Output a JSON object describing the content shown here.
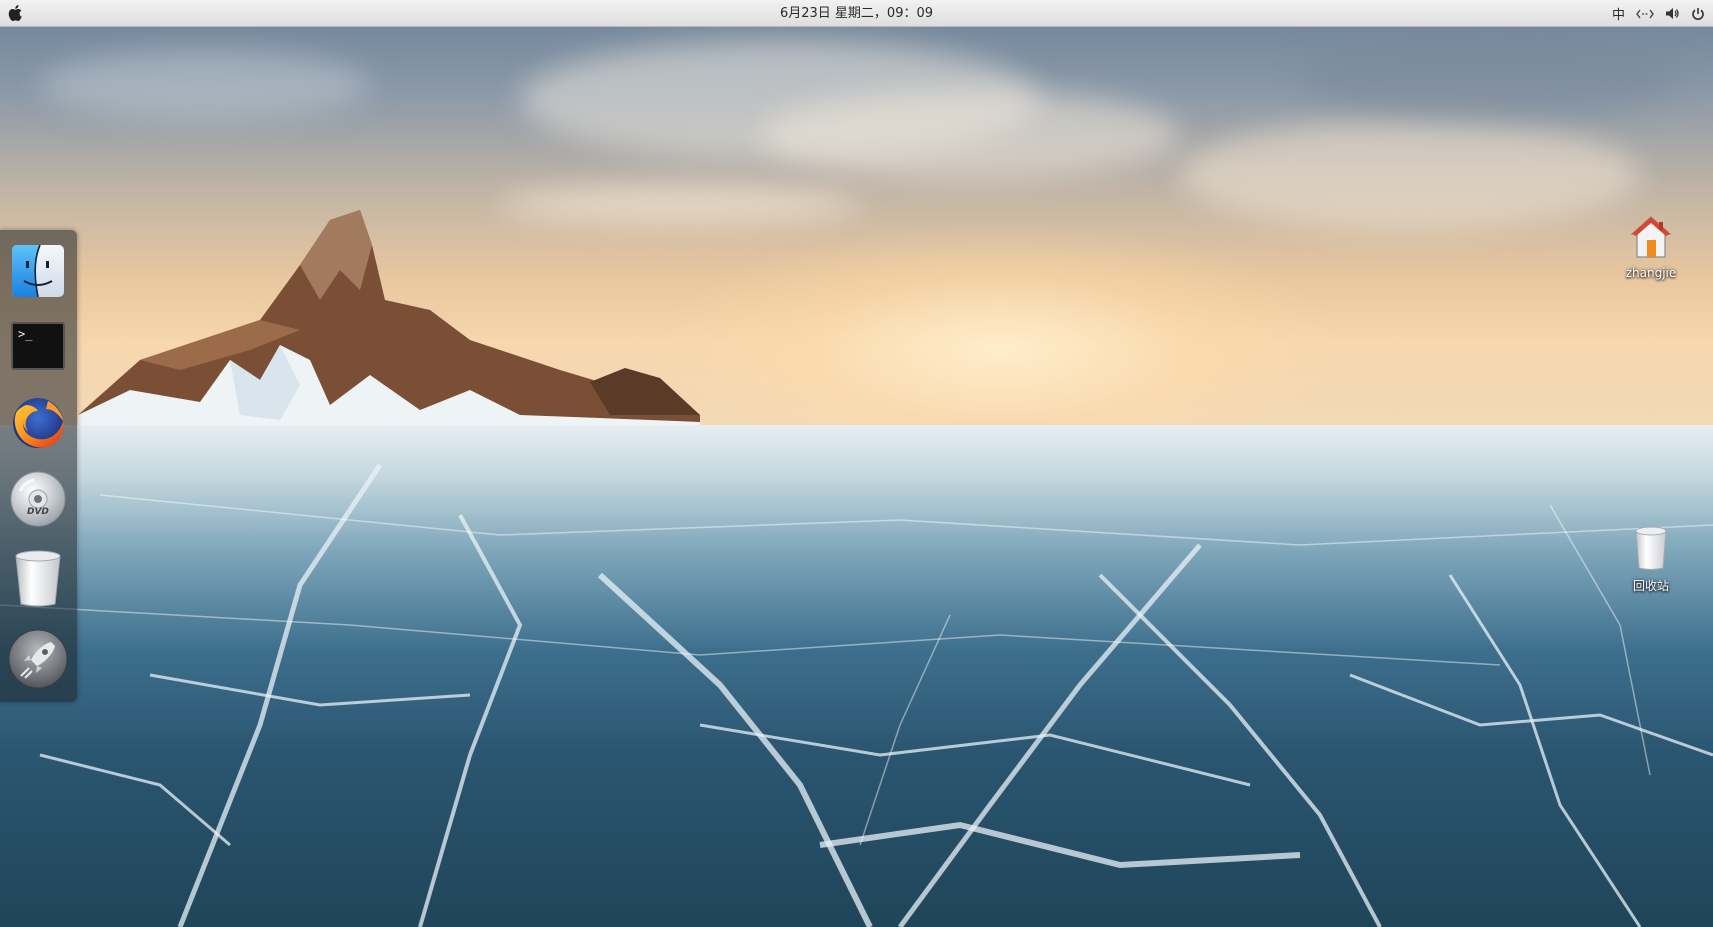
{
  "topbar": {
    "apple_menu_icon": "apple-logo-icon",
    "clock": "6月23日 星期二，09：09",
    "tray": {
      "input_method": "中",
      "network_icon": "network-icon",
      "volume_icon": "volume-icon",
      "power_icon": "power-icon"
    }
  },
  "dock": {
    "items": [
      {
        "name": "finder",
        "icon": "finder-icon"
      },
      {
        "name": "terminal",
        "icon": "terminal-icon",
        "prompt": ">_"
      },
      {
        "name": "firefox",
        "icon": "firefox-icon"
      },
      {
        "name": "dvd",
        "icon": "dvd-icon",
        "disc_label": "DVD"
      },
      {
        "name": "trash",
        "icon": "trash-icon"
      },
      {
        "name": "launcher",
        "icon": "rocket-icon"
      }
    ]
  },
  "desktop": {
    "icons": [
      {
        "label": "zhangjie",
        "icon": "home-folder-icon"
      },
      {
        "label": "回收站",
        "icon": "trash-icon"
      }
    ]
  },
  "colors": {
    "topbar_bg": "#e6e6e6",
    "dock_bg": "#1e2228",
    "sky_top": "#6d8299",
    "horizon": "#f6d7ae",
    "ice_deep": "#1f4559"
  }
}
